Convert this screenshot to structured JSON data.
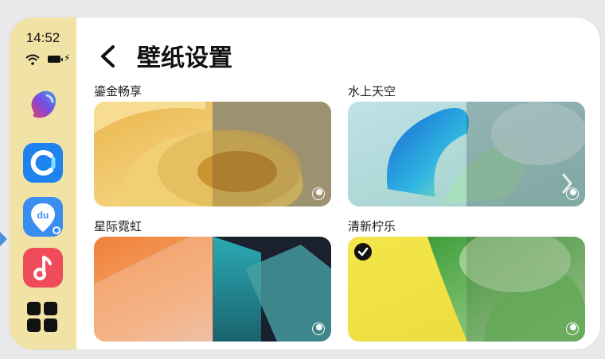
{
  "status": {
    "time": "14:52"
  },
  "dock": {
    "apps": [
      {
        "name": "assistant-app-icon"
      },
      {
        "name": "browser-app-icon"
      },
      {
        "name": "maps-app-icon",
        "text": "du"
      },
      {
        "name": "music-app-icon"
      },
      {
        "name": "app-grid-icon"
      }
    ]
  },
  "header": {
    "title": "壁纸设置"
  },
  "wallpapers": [
    {
      "label": "鎏金畅享",
      "selected": false
    },
    {
      "label": "水上天空",
      "selected": false
    },
    {
      "label": "星际霓虹",
      "selected": false
    },
    {
      "label": "清新柠乐",
      "selected": true
    }
  ],
  "colors": {
    "dock_bg": "#f1e2a6",
    "frame_bg": "#ffffff",
    "selected_check": "#111111"
  }
}
